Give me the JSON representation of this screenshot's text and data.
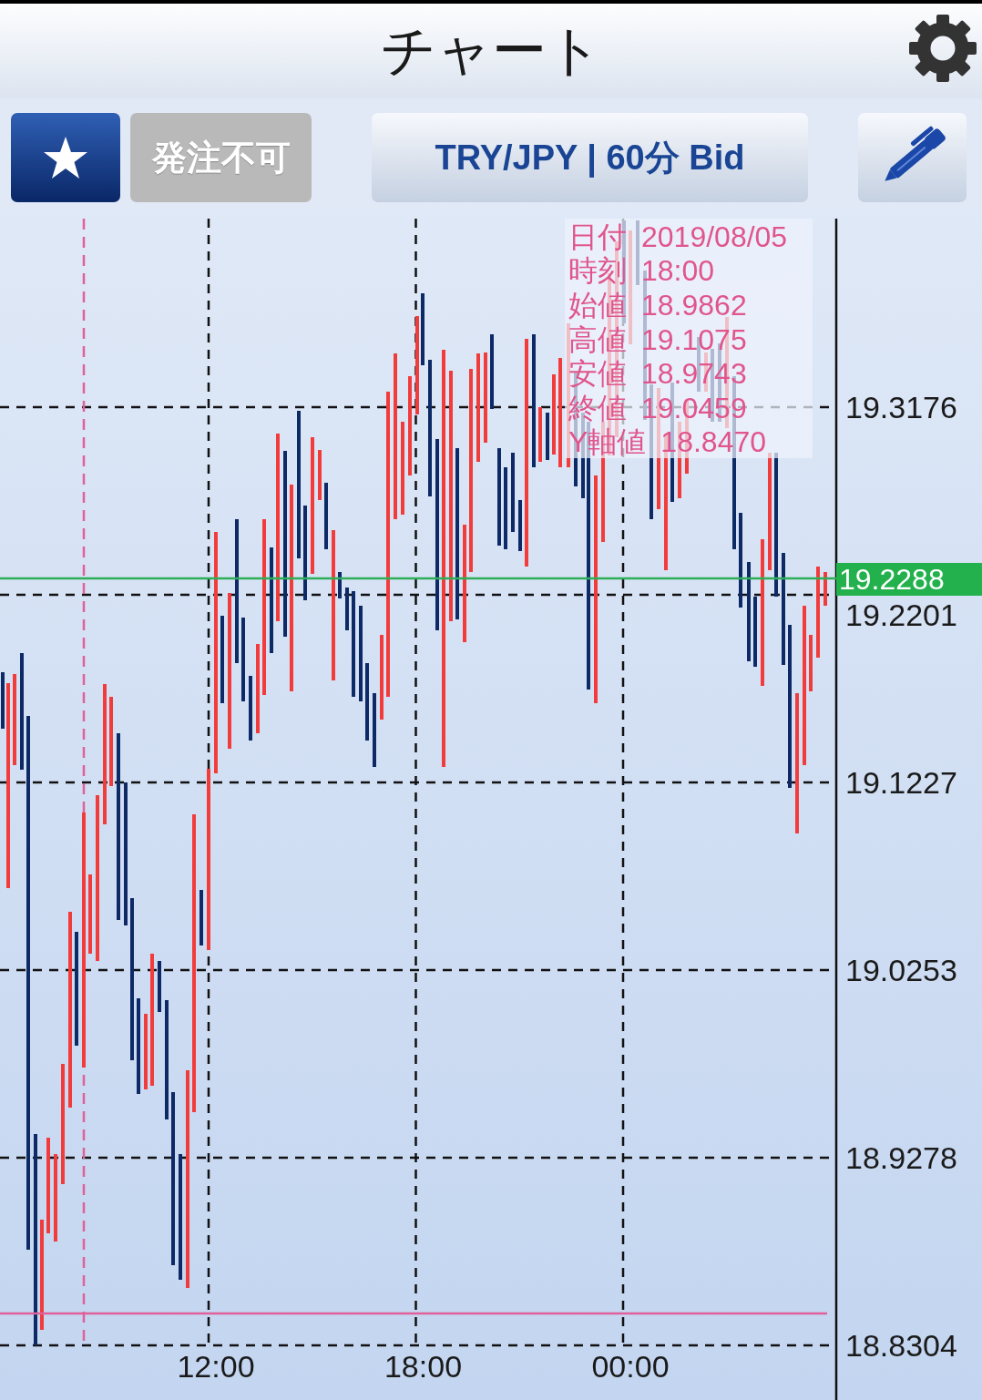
{
  "header": {
    "title": "チャート"
  },
  "toolbar": {
    "order_button": {
      "label": "発注不可",
      "disabled": true
    },
    "symbol_button": {
      "label": "TRY/JPY | 60分 Bid"
    }
  },
  "chart": {
    "y_axis_labels": [
      "19.3176",
      "19.2201",
      "19.1227",
      "19.0253",
      "18.9278",
      "18.8304"
    ],
    "x_axis_labels": [
      "12:00",
      "18:00",
      "00:00"
    ],
    "current_price": "19.2288",
    "tooltip": [
      {
        "label": "日付",
        "value": "2019/08/05"
      },
      {
        "label": "時刻",
        "value": "18:00"
      },
      {
        "label": "始値",
        "value": "18.9862"
      },
      {
        "label": "高値",
        "value": "19.1075"
      },
      {
        "label": "安値",
        "value": "18.9743"
      },
      {
        "label": "終値",
        "value": "19.0459"
      },
      {
        "label": "Y軸値",
        "value": "18.8470"
      }
    ]
  }
}
